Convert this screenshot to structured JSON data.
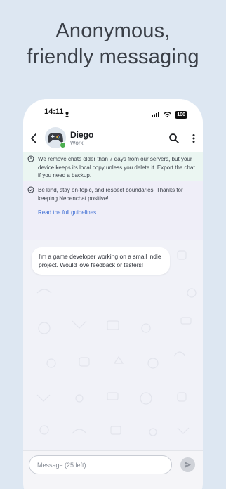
{
  "hero": {
    "line1": "Anonymous,",
    "line2": "friendly messaging"
  },
  "status_bar": {
    "time": "14:11",
    "battery": "100"
  },
  "header": {
    "contact_name": "Diego",
    "contact_label": "Work",
    "avatar_icon": "game-controller-icon",
    "online_color": "#4caf50"
  },
  "notices": {
    "retention": "We remove chats older than 7 days from our servers, but your device keeps its local copy unless you delete it. Export the chat if you need a backup.",
    "guidelines": "Be kind, stay on-topic, and respect boundaries. Thanks for keeping Nebenchat positive!",
    "guidelines_link": "Read the full guidelines"
  },
  "messages": [
    {
      "direction": "incoming",
      "text": "I'm a game developer working on a small indie project. Would love feedback or testers!"
    }
  ],
  "composer": {
    "placeholder": "Message (25 left)",
    "value": ""
  },
  "colors": {
    "page_background": "#dde7f2",
    "link": "#3f6fd4",
    "retention_notice_bg": "#ebf6f2",
    "guidelines_notice_bg": "#efeef8"
  }
}
